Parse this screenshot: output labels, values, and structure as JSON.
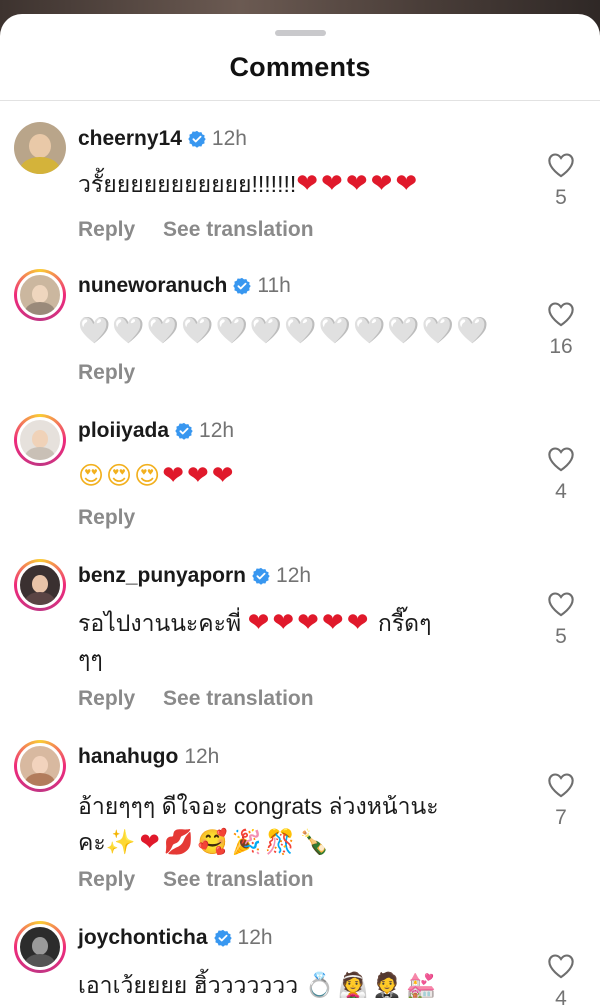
{
  "sheet": {
    "title": "Comments"
  },
  "comments": [
    {
      "username": "cheerny14",
      "verified": true,
      "time": "12h",
      "text": "วรั้ยยยยยยยยยยย!!!!!!!❤️❤️❤️❤️❤️",
      "text_plain": "วรั้ยยยยยยยยยยย!!!!!!!",
      "text_emoji": "❤❤❤❤❤",
      "reply_label": "Reply",
      "translate_label": "See translation",
      "likes": "5"
    },
    {
      "username": "nuneworanuch",
      "verified": true,
      "time": "11h",
      "text_emoji": "🤍🤍🤍🤍🤍🤍🤍🤍🤍🤍🤍🤍",
      "reply_label": "Reply",
      "likes": "16"
    },
    {
      "username": "ploiiyada",
      "verified": true,
      "time": "12h",
      "text_emoji_a": "😍😍😍",
      "text_emoji": "❤❤❤",
      "reply_label": "Reply",
      "likes": "4"
    },
    {
      "username": "benz_punyaporn",
      "verified": true,
      "time": "12h",
      "text_plain": "รอไปงานนะคะพี่",
      "text_emoji": "❤❤❤❤❤",
      "text_tail": "กรี๊ดๆ",
      "text_line2": "ๆๆ",
      "reply_label": "Reply",
      "translate_label": "See translation",
      "likes": "5"
    },
    {
      "username": "hanahugo",
      "verified": false,
      "time": "12h",
      "text_plain": "อ้ายๆๆๆ ดีใจอะ congrats ล่วงหน้านะ",
      "text_line2": "คะ",
      "text_emoji": "✨❤💋🥰🎉🎊🍾",
      "reply_label": "Reply",
      "translate_label": "See translation",
      "likes": "7"
    },
    {
      "username": "joychonticha",
      "verified": true,
      "time": "12h",
      "text_plain": "เอาเว้ยยยย ฮิ้ววววววว",
      "text_emoji": "💍👰🤵💒",
      "likes": "4"
    }
  ],
  "colors": {
    "accent_verified": "#3897f0",
    "heart_red": "#e0192b",
    "muted": "#8a8a8a"
  },
  "icons": {
    "verified": "verified-badge-icon",
    "like": "heart-outline-icon"
  }
}
